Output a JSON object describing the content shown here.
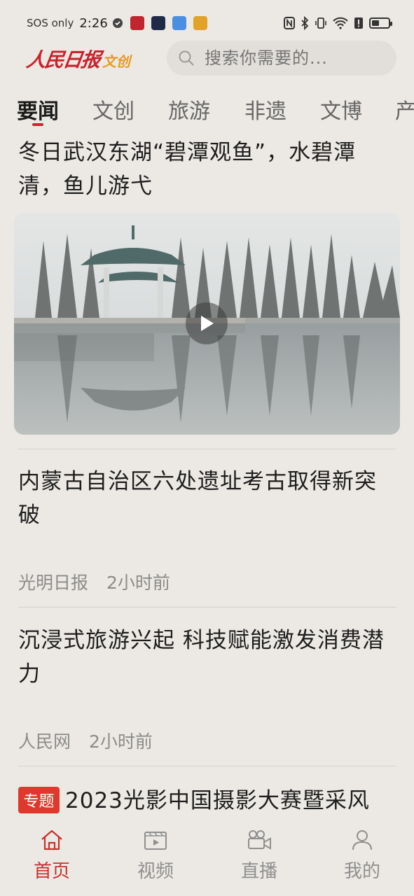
{
  "status_bar": {
    "carrier": "SOS only",
    "time": "2:26",
    "battery_level": 0.4
  },
  "header": {
    "logo_main": "人民日报",
    "logo_sub": "文创",
    "search_placeholder": "搜索你需要的..."
  },
  "tabs": [
    {
      "label": "要闻",
      "active": true
    },
    {
      "label": "文创",
      "active": false
    },
    {
      "label": "旅游",
      "active": false
    },
    {
      "label": "非遗",
      "active": false
    },
    {
      "label": "文博",
      "active": false
    },
    {
      "label": "产",
      "active": false
    }
  ],
  "feed": {
    "items": [
      {
        "title": "冬日武汉东湖“碧潭观鱼”，水碧潭清，鱼儿游弋",
        "has_video": true
      },
      {
        "title": "内蒙古自治区六处遗址考古取得新突破",
        "source": "光明日报",
        "time": "2小时前"
      },
      {
        "title": "沉浸式旅游兴起 科技赋能激发消费潜力",
        "source": "人民网",
        "time": "2小时前"
      },
      {
        "badge": "专题",
        "title": "2023光影中国摄影大赛暨采风"
      }
    ]
  },
  "bottom_nav": [
    {
      "label": "首页",
      "icon": "home-icon",
      "active": true
    },
    {
      "label": "视频",
      "icon": "video-icon",
      "active": false
    },
    {
      "label": "直播",
      "icon": "camera-icon",
      "active": false
    },
    {
      "label": "我的",
      "icon": "person-icon",
      "active": false
    }
  ],
  "colors": {
    "accent": "#d0232a",
    "background": "#ece9e4",
    "badge": "#e0382c"
  }
}
